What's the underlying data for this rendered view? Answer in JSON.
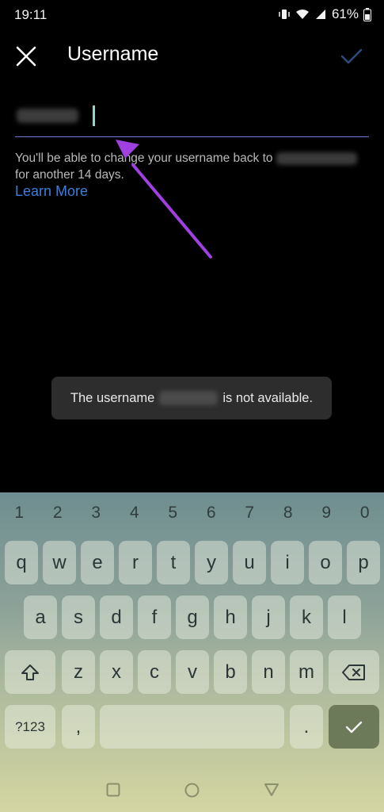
{
  "status": {
    "time": "19:11",
    "battery": "61%"
  },
  "header": {
    "title": "Username"
  },
  "field": {
    "value_hidden": ""
  },
  "helper": {
    "line1": "You'll be able to change your username back to",
    "line2": "for another 14 days."
  },
  "learn_more": "Learn More",
  "toast": {
    "prefix": "The username",
    "suffix": "is not available."
  },
  "keyboard": {
    "numbers": [
      "1",
      "2",
      "3",
      "4",
      "5",
      "6",
      "7",
      "8",
      "9",
      "0"
    ],
    "row1": [
      "q",
      "w",
      "e",
      "r",
      "t",
      "y",
      "u",
      "i",
      "o",
      "p"
    ],
    "row2": [
      "a",
      "s",
      "d",
      "f",
      "g",
      "h",
      "j",
      "k",
      "l"
    ],
    "row3": [
      "z",
      "x",
      "c",
      "v",
      "b",
      "n",
      "m"
    ],
    "symbols": "?123",
    "comma": ",",
    "period": "."
  },
  "colors": {
    "accent": "#3d7fd6",
    "underline": "#6a7ad6",
    "annotation_arrow": "#a040e0",
    "caret": "#8fd8d2"
  }
}
